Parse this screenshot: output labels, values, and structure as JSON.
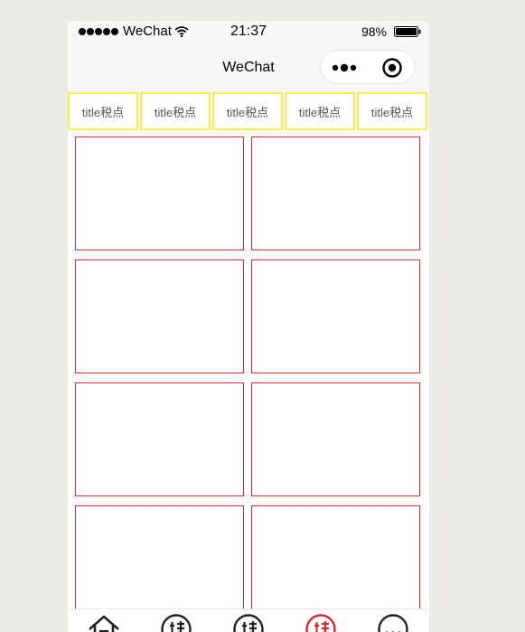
{
  "status_bar": {
    "carrier": "WeChat",
    "time": "21:37",
    "battery": "98%"
  },
  "nav": {
    "title": "WeChat"
  },
  "tabs": [
    {
      "label": "title税点"
    },
    {
      "label": "title税点"
    },
    {
      "label": "title税点"
    },
    {
      "label": "title税点"
    },
    {
      "label": "title税点"
    }
  ],
  "grid_cards": [
    {
      "text": ""
    },
    {
      "text": ""
    },
    {
      "text": ""
    },
    {
      "text": ""
    },
    {
      "text": ""
    },
    {
      "text": ""
    },
    {
      "text": ""
    },
    {
      "text": ""
    }
  ],
  "tabbar": {
    "items": [
      {
        "icon": "home-icon"
      },
      {
        "icon": "special-icon"
      },
      {
        "icon": "special-icon"
      },
      {
        "icon": "special-active-icon"
      },
      {
        "icon": "more-icon"
      }
    ]
  },
  "colors": {
    "page_bg": "#ecebe8",
    "tab_border": "#f5f04a",
    "card_border": "#d9272e",
    "active_icon": "#d9272e"
  }
}
